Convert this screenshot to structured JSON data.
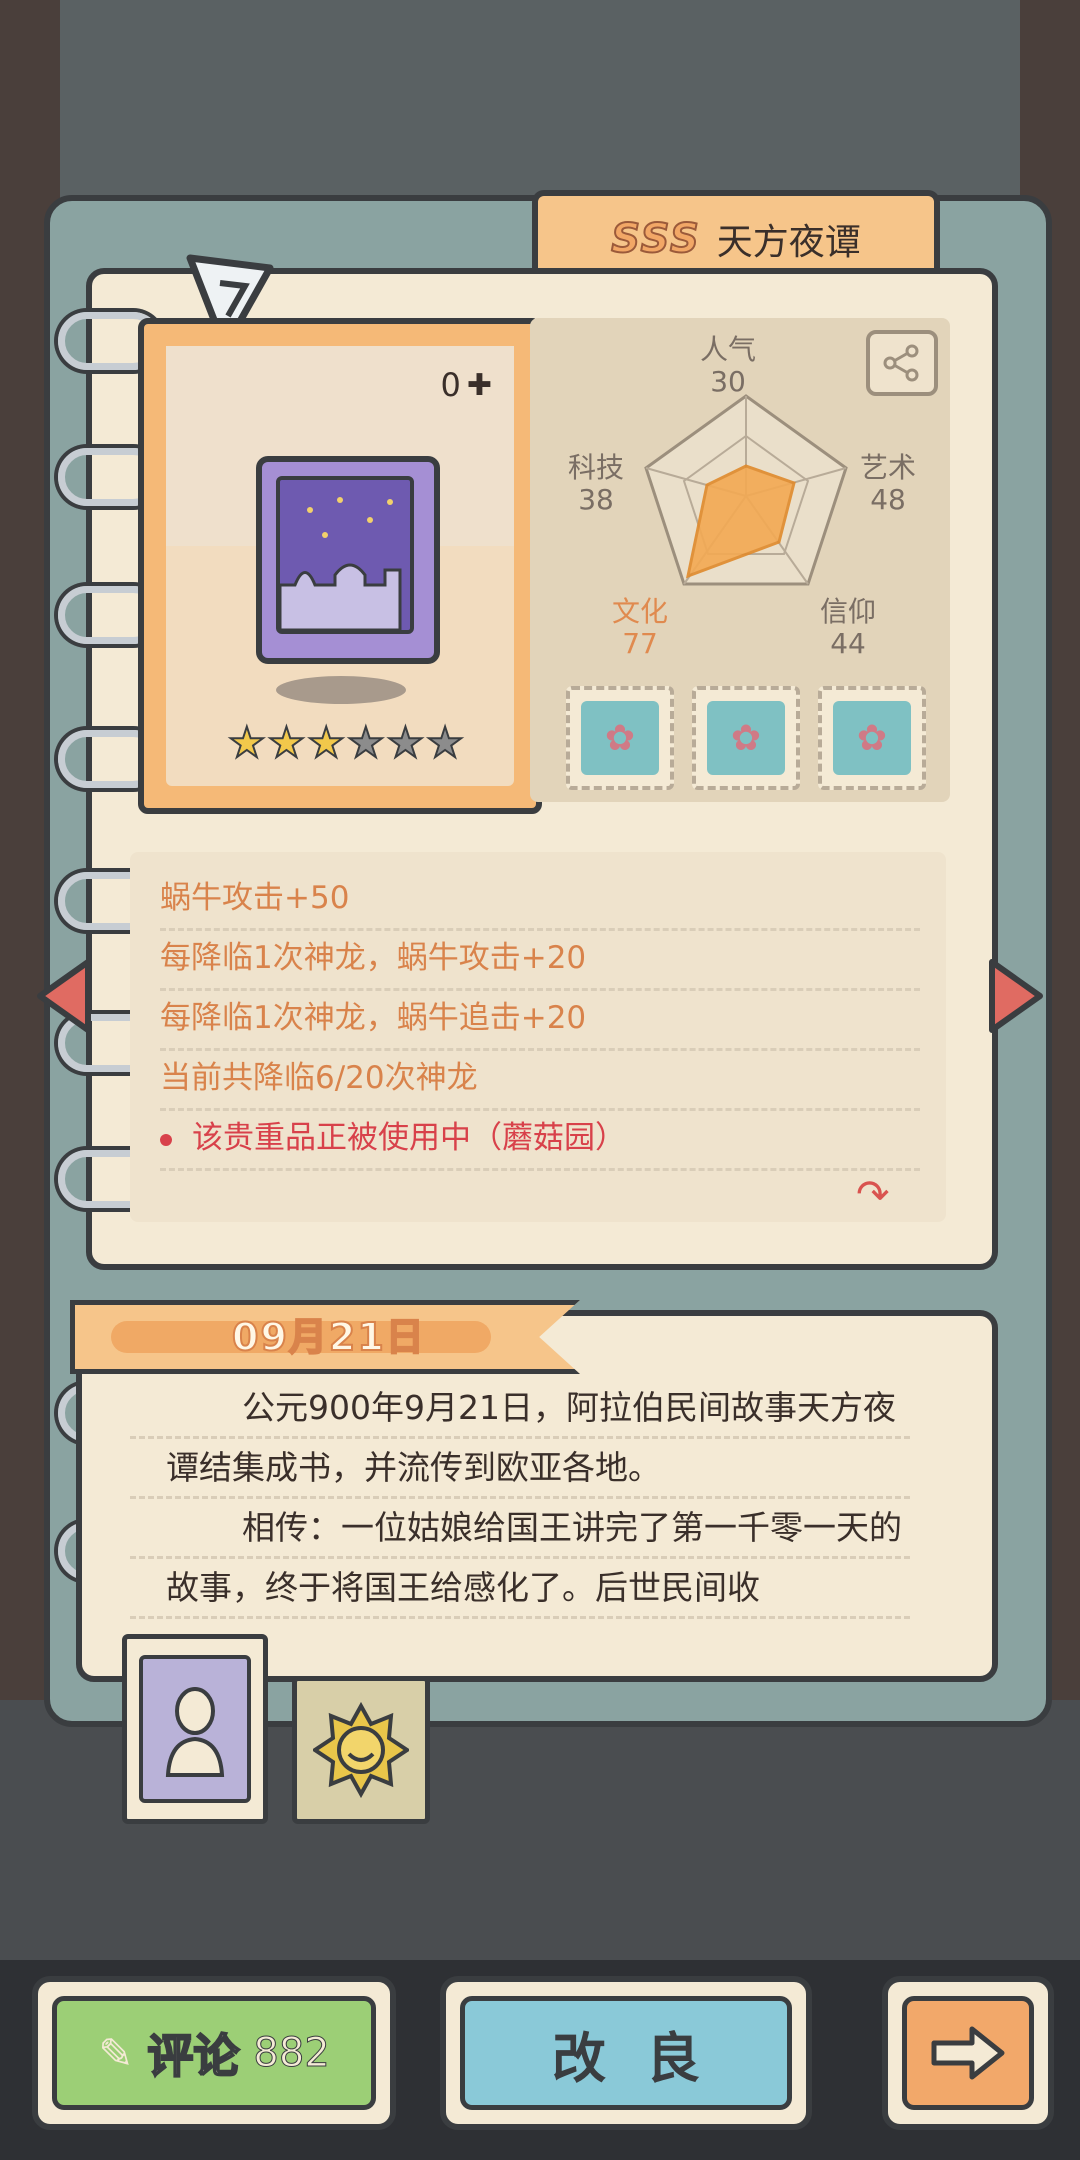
{
  "item": {
    "rank": "SSS",
    "name": "天方夜谭",
    "count": "0",
    "stars_filled": 3,
    "stars_total": 6
  },
  "stats": {
    "popularity": {
      "label": "人气",
      "value": "30"
    },
    "art": {
      "label": "艺术",
      "value": "48"
    },
    "faith": {
      "label": "信仰",
      "value": "44"
    },
    "culture": {
      "label": "文化",
      "value": "77"
    },
    "tech": {
      "label": "科技",
      "value": "38"
    }
  },
  "badges": [
    "snail-nest-icon",
    "snail-nest-icon",
    "snail-nest-icon"
  ],
  "effects": [
    "蜗牛攻击+50",
    "每降临1次神龙，蜗牛攻击+20",
    "每降临1次神龙，蜗牛追击+20",
    "当前共降临6/20次神龙"
  ],
  "status_note": "该贵重品正被使用中（蘑菇园）",
  "story": {
    "date": "09月21日",
    "paragraph1": "公元900年9月21日，阿拉伯民间故事天方夜谭结集成书，并流传到欧亚各地。",
    "paragraph2": "相传：一位姑娘给国王讲完了第一千零一天的故事，终于将国王给感化了。后世民间收"
  },
  "buttons": {
    "comment_label": "评论",
    "comment_count": "882",
    "improve_label": "改良"
  },
  "colors": {
    "accent_orange": "#f2a766",
    "effect_text": "#d9834b",
    "warning_red": "#d8414a",
    "comment_green": "#9ccf76",
    "improve_blue": "#8ac9d8"
  }
}
